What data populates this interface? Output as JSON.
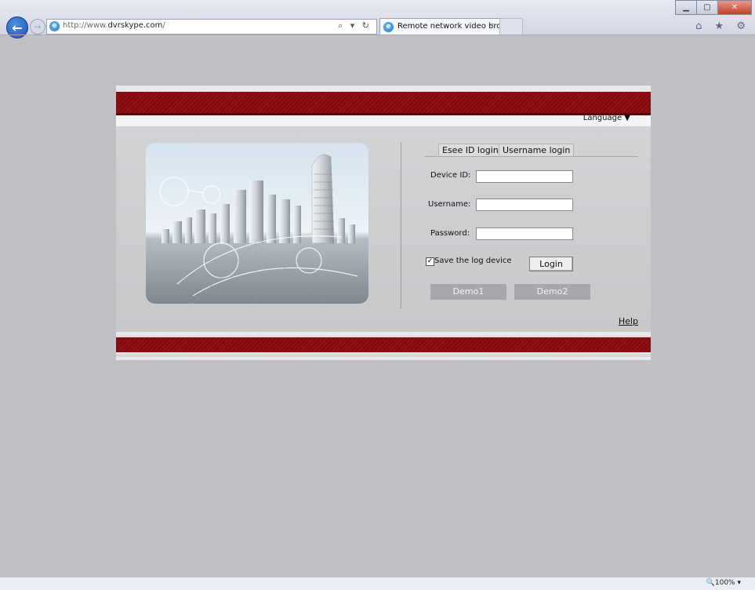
{
  "browser": {
    "url_prefix": "http://www.",
    "url_domain": "dvrskype.com",
    "url_suffix": "/",
    "search_refresh": "⌕ ▾ ↻",
    "tab_title": "Remote network video bro...",
    "tab_close": "×",
    "right_icons": "⌂ ★ ⚙",
    "zoom": "🔍100% ▾"
  },
  "page": {
    "language_label": "Language ▼",
    "tabs": [
      "Esee ID login",
      "Username login"
    ],
    "device_id_label": "Device ID:",
    "username_label": "Username:",
    "password_label": "Password:",
    "save_label": "Save the log device",
    "save_checked": true,
    "login_label": "Login",
    "demo1_label": "Demo1",
    "demo2_label": "Demo2",
    "help_label": "Help"
  }
}
